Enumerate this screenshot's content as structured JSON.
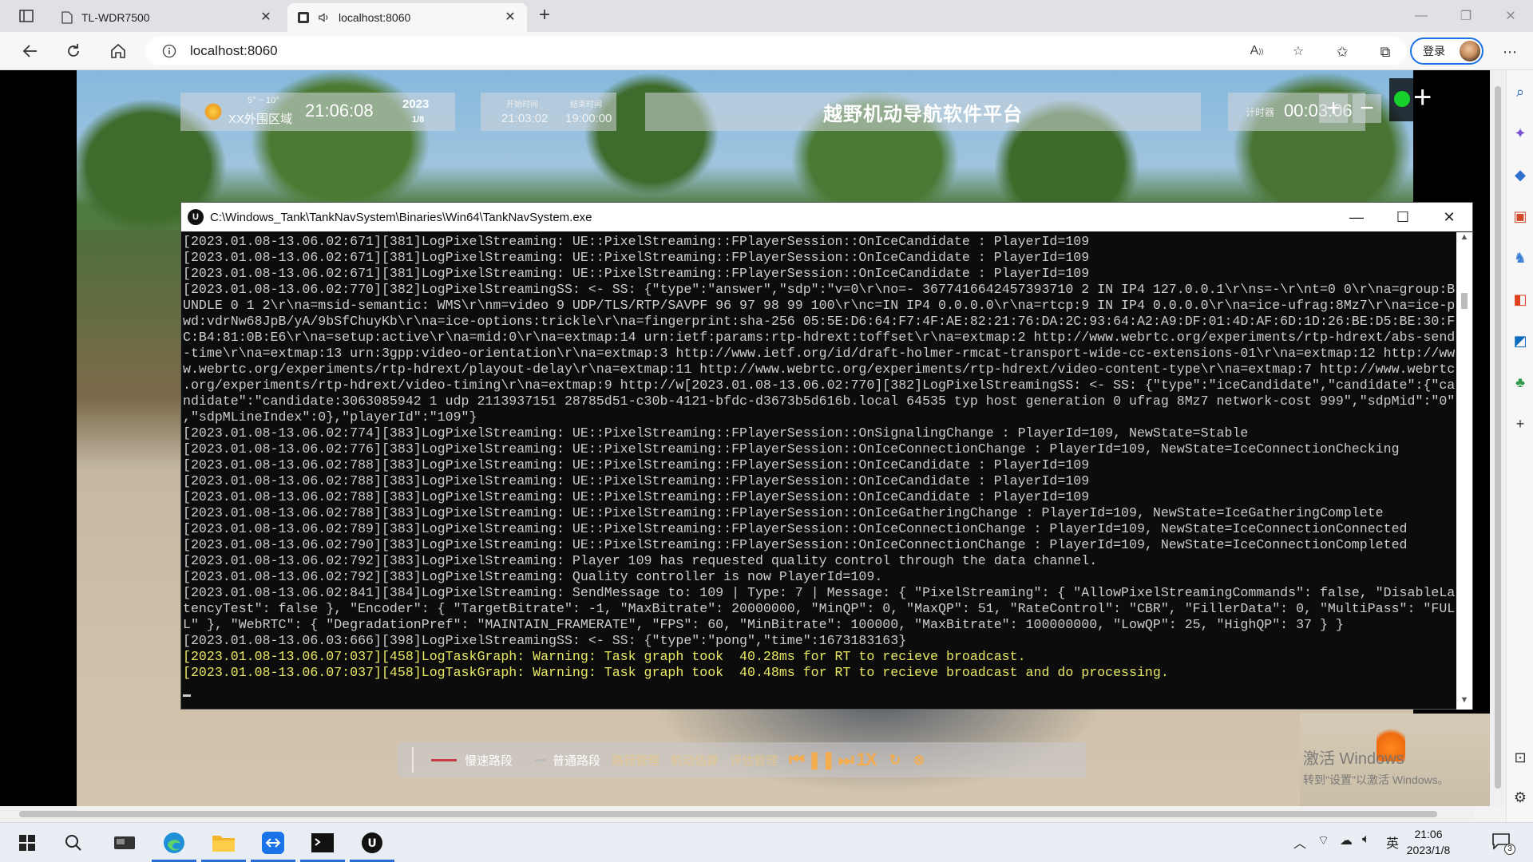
{
  "browser": {
    "tabs": [
      {
        "title": "TL-WDR7500",
        "active": false
      },
      {
        "title": "localhost:8060",
        "active": true
      }
    ],
    "url": "localhost:8060",
    "login_label": "登录"
  },
  "hud": {
    "temperature": "5° ~ 10°",
    "region": "XX外围区域",
    "clock": "21:06:08",
    "year": "2023",
    "date": "1/8",
    "start_label": "开始时间",
    "start_time": "21:03:02",
    "end_label": "结束时间",
    "end_time": "19:00:00",
    "title": "越野机动导航软件平台",
    "timer_label": "计时器",
    "timer_value": "00:03:06",
    "status_color": "#19d12c"
  },
  "bottom_bar": {
    "fast_route": "慢速路段",
    "normal_route": "普通路段",
    "item3": "路径管理",
    "item4": "机动估算",
    "item5": "评估管理",
    "speed": "1X"
  },
  "activation": {
    "line1": "激活 Windows",
    "line2": "转到\"设置\"以激活 Windows。"
  },
  "console": {
    "title": "C:\\Windows_Tank\\TankNavSystem\\Binaries\\Win64\\TankNavSystem.exe",
    "lines": [
      "[2023.01.08-13.06.02:671][381]LogPixelStreaming: UE::PixelStreaming::FPlayerSession::OnIceCandidate : PlayerId=109",
      "[2023.01.08-13.06.02:671][381]LogPixelStreaming: UE::PixelStreaming::FPlayerSession::OnIceCandidate : PlayerId=109",
      "[2023.01.08-13.06.02:671][381]LogPixelStreaming: UE::PixelStreaming::FPlayerSession::OnIceCandidate : PlayerId=109",
      "[2023.01.08-13.06.02:770][382]LogPixelStreamingSS: <- SS: {\"type\":\"answer\",\"sdp\":\"v=0\\r\\no=- 3677416642457393710 2 IN IP4 127.0.0.1\\r\\ns=-\\r\\nt=0 0\\r\\na=group:B",
      "UNDLE 0 1 2\\r\\na=msid-semantic: WMS\\r\\nm=video 9 UDP/TLS/RTP/SAVPF 96 97 98 99 100\\r\\nc=IN IP4 0.0.0.0\\r\\na=rtcp:9 IN IP4 0.0.0.0\\r\\na=ice-ufrag:8Mz7\\r\\na=ice-p",
      "wd:vdrNw68JpB/yA/9bSfChuyKb\\r\\na=ice-options:trickle\\r\\na=fingerprint:sha-256 05:5E:D6:64:F7:4F:AE:82:21:76:DA:2C:93:64:A2:A9:DF:01:4D:AF:6D:1D:26:BE:D5:BE:30:F",
      "C:B4:81:0B:E6\\r\\na=setup:active\\r\\na=mid:0\\r\\na=extmap:14 urn:ietf:params:rtp-hdrext:toffset\\r\\na=extmap:2 http://www.webrtc.org/experiments/rtp-hdrext/abs-send",
      "-time\\r\\na=extmap:13 urn:3gpp:video-orientation\\r\\na=extmap:3 http://www.ietf.org/id/draft-holmer-rmcat-transport-wide-cc-extensions-01\\r\\na=extmap:12 http://ww",
      "w.webrtc.org/experiments/rtp-hdrext/playout-delay\\r\\na=extmap:11 http://www.webrtc.org/experiments/rtp-hdrext/video-content-type\\r\\na=extmap:7 http://www.webrtc",
      ".org/experiments/rtp-hdrext/video-timing\\r\\na=extmap:9 http://w[2023.01.08-13.06.02:770][382]LogPixelStreamingSS: <- SS: {\"type\":\"iceCandidate\",\"candidate\":{\"ca",
      "ndidate\":\"candidate:3063085942 1 udp 2113937151 28785d51-c30b-4121-bfdc-d3673b5d616b.local 64535 typ host generation 0 ufrag 8Mz7 network-cost 999\",\"sdpMid\":\"0\"",
      ",\"sdpMLineIndex\":0},\"playerId\":\"109\"}",
      "[2023.01.08-13.06.02:774][383]LogPixelStreaming: UE::PixelStreaming::FPlayerSession::OnSignalingChange : PlayerId=109, NewState=Stable",
      "[2023.01.08-13.06.02:776][383]LogPixelStreaming: UE::PixelStreaming::FPlayerSession::OnIceConnectionChange : PlayerId=109, NewState=IceConnectionChecking",
      "[2023.01.08-13.06.02:788][383]LogPixelStreaming: UE::PixelStreaming::FPlayerSession::OnIceCandidate : PlayerId=109",
      "[2023.01.08-13.06.02:788][383]LogPixelStreaming: UE::PixelStreaming::FPlayerSession::OnIceCandidate : PlayerId=109",
      "[2023.01.08-13.06.02:788][383]LogPixelStreaming: UE::PixelStreaming::FPlayerSession::OnIceCandidate : PlayerId=109",
      "[2023.01.08-13.06.02:788][383]LogPixelStreaming: UE::PixelStreaming::FPlayerSession::OnIceGatheringChange : PlayerId=109, NewState=IceGatheringComplete",
      "[2023.01.08-13.06.02:789][383]LogPixelStreaming: UE::PixelStreaming::FPlayerSession::OnIceConnectionChange : PlayerId=109, NewState=IceConnectionConnected",
      "[2023.01.08-13.06.02:790][383]LogPixelStreaming: UE::PixelStreaming::FPlayerSession::OnIceConnectionChange : PlayerId=109, NewState=IceConnectionCompleted",
      "[2023.01.08-13.06.02:792][383]LogPixelStreaming: Player 109 has requested quality control through the data channel.",
      "[2023.01.08-13.06.02:792][383]LogPixelStreaming: Quality controller is now PlayerId=109.",
      "[2023.01.08-13.06.02:841][384]LogPixelStreaming: SendMessage to: 109 | Type: 7 | Message: { \"PixelStreaming\": { \"AllowPixelStreamingCommands\": false, \"DisableLa",
      "tencyTest\": false }, \"Encoder\": { \"TargetBitrate\": -1, \"MaxBitrate\": 20000000, \"MinQP\": 0, \"MaxQP\": 51, \"RateControl\": \"CBR\", \"FillerData\": 0, \"MultiPass\": \"FUL",
      "L\" }, \"WebRTC\": { \"DegradationPref\": \"MAINTAIN_FRAMERATE\", \"FPS\": 60, \"MinBitrate\": 100000, \"MaxBitrate\": 100000000, \"LowQP\": 25, \"HighQP\": 37 } }",
      "[2023.01.08-13.06.03:666][398]LogPixelStreamingSS: <- SS: {\"type\":\"pong\",\"time\":1673183163}"
    ],
    "warnings": [
      "[2023.01.08-13.06.07:037][458]LogTaskGraph: Warning: Task graph took  40.28ms for RT to recieve broadcast.",
      "[2023.01.08-13.06.07:037][458]LogTaskGraph: Warning: Task graph took  40.48ms for RT to recieve broadcast and do processing."
    ]
  },
  "taskbar": {
    "ime": "英",
    "time": "21:06",
    "date": "2023/1/8",
    "notifications": "3"
  }
}
